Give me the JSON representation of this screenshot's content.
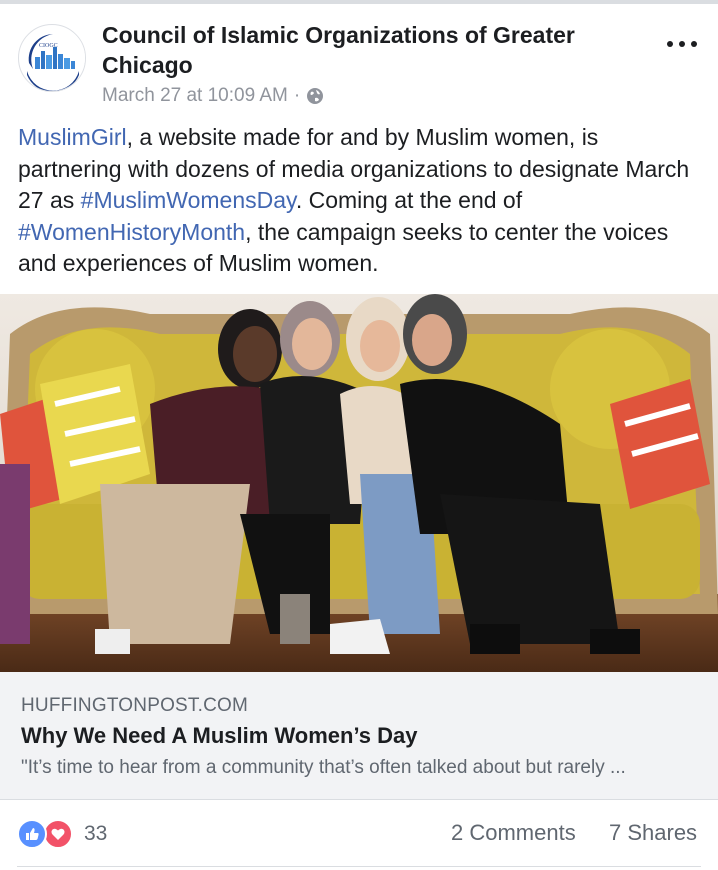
{
  "post": {
    "page_name": "Council of Islamic Organizations of Greater Chicago",
    "avatar_text": "CIOGC",
    "timestamp": "March 27 at 10:09 AM",
    "separator": "·",
    "privacy_icon": "globe-icon",
    "menu_icon": "more-options-icon",
    "text": {
      "link_muslimgirl": "MuslimGirl",
      "part1": ", a website made for and by Muslim women, is partnering with dozens of media organizations to designate March 27 as ",
      "hashtag_day": "#MuslimWomensDay",
      "part2": ". Coming at the end of ",
      "hashtag_month": "#WomenHistoryMonth",
      "part3": ", the campaign seeks to center the voices and experiences of Muslim women."
    }
  },
  "link_preview": {
    "domain": "HUFFINGTONPOST.COM",
    "title": "Why We Need A Muslim Women’s Day",
    "description": "\"It’s time to hear from a community that’s often talked about but rarely ..."
  },
  "engagement": {
    "reaction_icons": [
      "like-icon",
      "love-icon"
    ],
    "reaction_count": "33",
    "comments": "2 Comments",
    "shares": "7 Shares"
  },
  "colors": {
    "link": "#4267b2",
    "secondary_text": "#90949c",
    "like": "#5890ff",
    "love": "#f25268",
    "preview_bg": "#f2f3f5"
  }
}
